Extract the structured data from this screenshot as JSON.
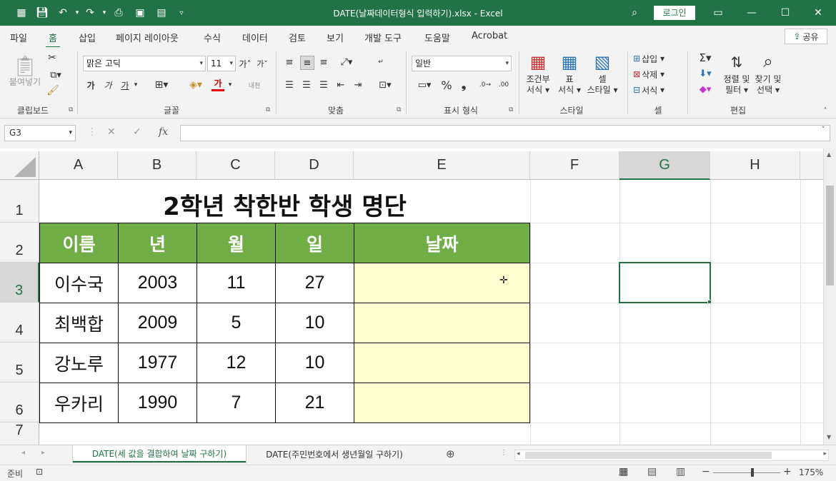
{
  "window": {
    "title": "DATE(날짜데이터형식 입력하기).xlsx  -  Excel",
    "login_label": "로그인"
  },
  "ribbon_tabs": [
    "파일",
    "홈",
    "삽입",
    "페이지 레이아웃",
    "수식",
    "데이터",
    "검토",
    "보기",
    "개발 도구",
    "도움말",
    "Acrobat"
  ],
  "active_tab": "홈",
  "share_label": "공유",
  "ribbon": {
    "clipboard": {
      "paste_label": "붙여넣기",
      "group_label": "클립보드"
    },
    "font": {
      "font_name": "맑은 고딕",
      "font_size": "11",
      "group_label": "글꼴",
      "bold": "가",
      "italic": "가",
      "underline": "가",
      "color_glyph": "가",
      "phonetic": "내천"
    },
    "alignment": {
      "group_label": "맞춤"
    },
    "number": {
      "format": "일반",
      "group_label": "표시 형식"
    },
    "styles": {
      "conditional": "조건부 서식",
      "table": "표 서식",
      "cell_style": "셀 스타일",
      "group_label": "스타일",
      "cond_l1": "조건부",
      "cond_l2": "서식",
      "tbl_l1": "표",
      "tbl_l2": "서식",
      "cs_l1": "셀",
      "cs_l2": "스타일"
    },
    "cells": {
      "insert": "삽입",
      "delete": "삭제",
      "format": "서식",
      "group_label": "셀"
    },
    "editing": {
      "sort_l1": "정렬 및",
      "sort_l2": "필터",
      "find_l1": "찾기 및",
      "find_l2": "선택",
      "group_label": "편집"
    }
  },
  "formula_bar": {
    "name_box": "G3",
    "fx": "fx",
    "formula": ""
  },
  "columns": [
    "A",
    "B",
    "C",
    "D",
    "E",
    "F",
    "G",
    "H"
  ],
  "selected_column": "G",
  "rows": [
    "1",
    "2",
    "3",
    "4",
    "5",
    "6",
    "7"
  ],
  "selected_row": "3",
  "sheet": {
    "title": "2학년 착한반 학생 명단",
    "headers": [
      "이름",
      "년",
      "월",
      "일",
      "날짜"
    ],
    "data": [
      [
        "이수국",
        "2003",
        "11",
        "27",
        ""
      ],
      [
        "최백합",
        "2009",
        "5",
        "10",
        ""
      ],
      [
        "강노루",
        "1977",
        "12",
        "10",
        ""
      ],
      [
        "우카리",
        "1990",
        "7",
        "21",
        ""
      ]
    ]
  },
  "sheet_tabs": [
    "DATE(세 값을 결합하여 날짜 구하기)",
    "DATE(주민번호에서 생년월일 구하기)"
  ],
  "status": {
    "ready": "준비",
    "zoom": "175%"
  },
  "colors": {
    "excel_green": "#217346",
    "header_fill": "#70ad47",
    "date_fill": "#fefed0"
  }
}
